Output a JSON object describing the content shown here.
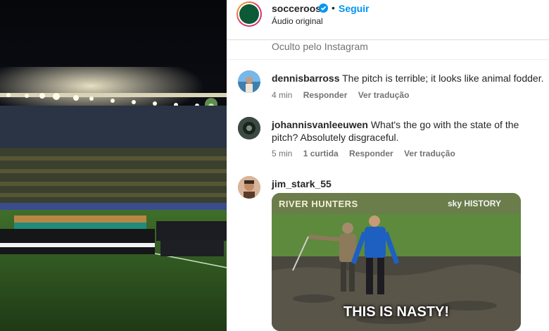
{
  "post": {
    "username": "socceroos",
    "follow_label": "Seguir",
    "separator": "•",
    "audio": "Áudio original",
    "hidden_note": "Oculto pelo Instagram"
  },
  "comments": [
    {
      "username": "dennisbarross",
      "text": "The pitch is terrible; it looks like animal fodder.",
      "time": "4 min",
      "reply": "Responder",
      "translate": "Ver tradução"
    },
    {
      "username": "johannisvanleeuwen",
      "text": "What's the go with the state of the pitch? Absolutely disgraceful.",
      "time": "5 min",
      "likes": "1 curtida",
      "reply": "Responder",
      "translate": "Ver tradução"
    },
    {
      "username": "jim_stark_55",
      "video": {
        "show_title": "RIVER HUNTERS",
        "channel": "sky HISTORY",
        "caption": "THIS IS NASTY!"
      }
    }
  ],
  "colors": {
    "link_blue": "#0095f6",
    "text": "#262626",
    "muted": "#737373"
  }
}
